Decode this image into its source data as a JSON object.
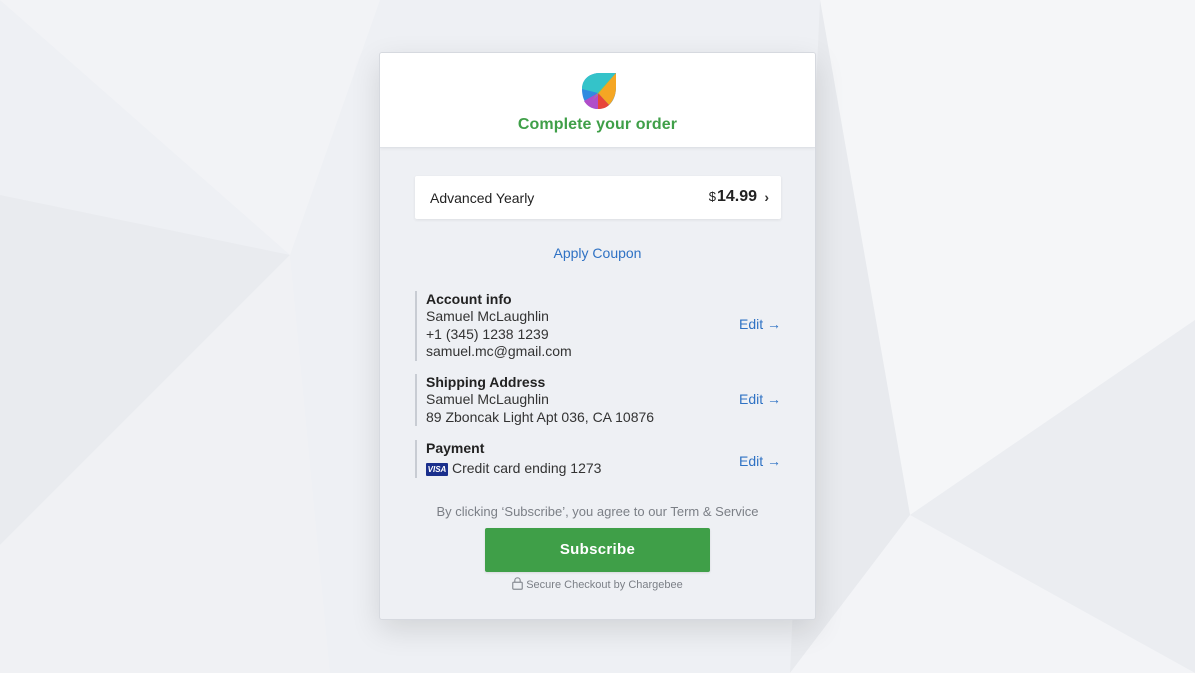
{
  "header": {
    "title": "Complete your order"
  },
  "plan": {
    "name": "Advanced Yearly",
    "currency": "$",
    "price": "14.99",
    "chevron": "›"
  },
  "coupon": {
    "label": "Apply Coupon"
  },
  "account": {
    "title": "Account info",
    "name": "Samuel McLaughlin",
    "phone": "+1 (345) 1238 1239",
    "email": "samuel.mc@gmail.com",
    "edit_label": "Edit →"
  },
  "shipping": {
    "title": "Shipping Address",
    "name": "Samuel McLaughlin",
    "address": "89 Zboncak Light Apt 036, CA 10876",
    "edit_label": "Edit →"
  },
  "payment": {
    "title": "Payment",
    "card_brand": "VISA",
    "card_text": "Credit card ending 1273",
    "edit_label": "Edit →"
  },
  "footer": {
    "terms": "By clicking ‘Subscribe’, you agree to our Term & Service",
    "subscribe_label": "Subscribe",
    "secure_text": "Secure Checkout by Chargebee"
  },
  "colors": {
    "brand_green": "#3f9f48",
    "link_blue": "#2f72c4",
    "background": "#eef0f4"
  },
  "icons": {
    "logo": "chargebee-logo-icon",
    "lock": "lock-icon",
    "card": "visa-icon"
  }
}
